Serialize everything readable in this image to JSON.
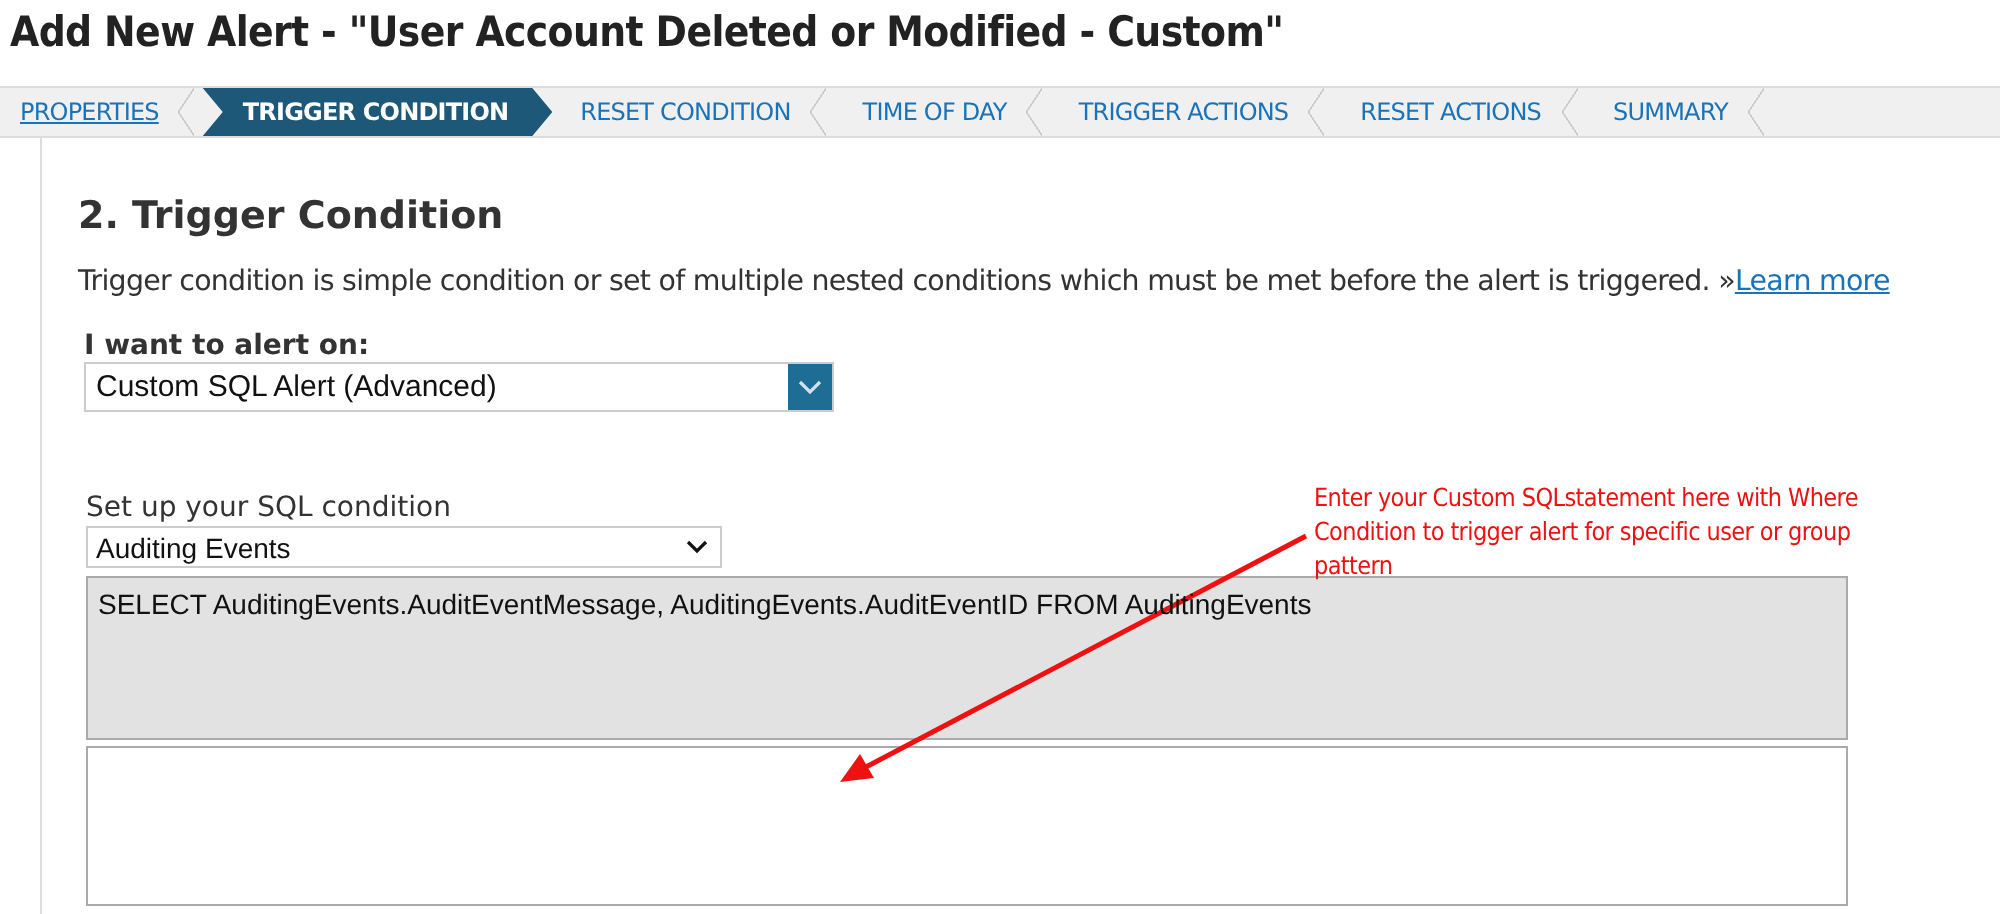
{
  "page_title": "Add New Alert - \"User Account Deleted or Modified - Custom\"",
  "steps": [
    {
      "label": "PROPERTIES",
      "selected": false,
      "completed": true
    },
    {
      "label": "TRIGGER CONDITION",
      "selected": true,
      "completed": false
    },
    {
      "label": "RESET CONDITION",
      "selected": false,
      "completed": false
    },
    {
      "label": "TIME OF DAY",
      "selected": false,
      "completed": false
    },
    {
      "label": "TRIGGER ACTIONS",
      "selected": false,
      "completed": false
    },
    {
      "label": "RESET ACTIONS",
      "selected": false,
      "completed": false
    },
    {
      "label": "SUMMARY",
      "selected": false,
      "completed": false
    }
  ],
  "section": {
    "heading": "2. Trigger Condition",
    "description": "Trigger condition is simple condition or set of multiple nested conditions which must be met before the alert is triggered. »",
    "learn_more": "Learn more",
    "alert_on": {
      "label": "I want to alert on:",
      "value": "Custom SQL Alert (Advanced)"
    },
    "sql_condition": {
      "label": "Set up your SQL condition",
      "value": "Auditing Events",
      "query": "SELECT AuditingEvents.AuditEventMessage, AuditingEvents.AuditEventID FROM AuditingEvents"
    }
  },
  "annotation": {
    "text": "Enter your Custom SQLstatement here with Where Condition to trigger alert for specific user or group pattern"
  }
}
